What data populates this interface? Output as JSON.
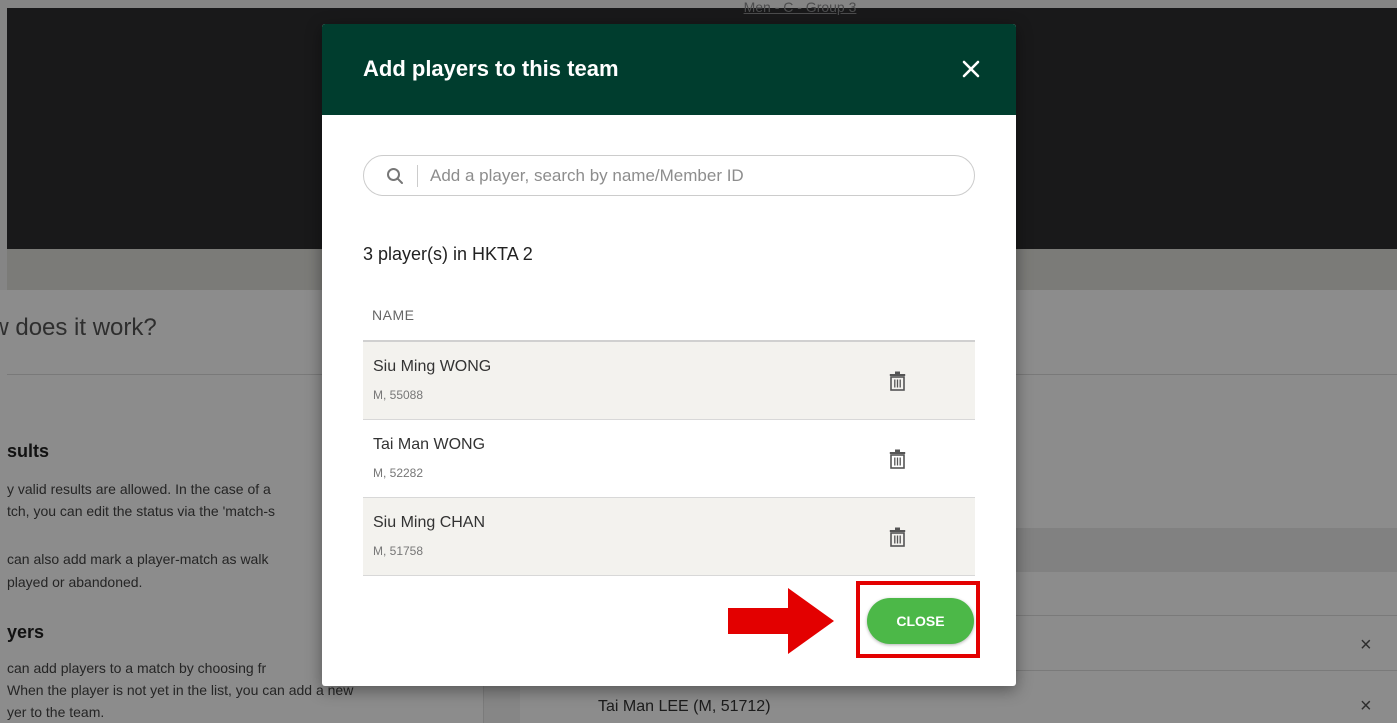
{
  "background": {
    "header_subtitle": "Men - C - Group 3",
    "section_title": "ow does it work?",
    "results": {
      "heading": "sults",
      "lines": [
        "y valid results are allowed. In the case of a",
        "tch, you can edit the status via the 'match-s",
        "",
        "can also add mark a player-match as walk",
        "played or abandoned."
      ]
    },
    "players": {
      "heading": "yers",
      "lines": [
        "can add players to a match by choosing fr",
        "When the player is not yet in the list, you can add a new",
        "yer to the team."
      ]
    },
    "right_row_text": "Tai Man LEE (M, 51712)",
    "remove_glyph": "×"
  },
  "modal": {
    "title": "Add players to this team",
    "search": {
      "placeholder": "Add a player, search by name/Member ID"
    },
    "count_text": "3 player(s) in HKTA 2",
    "column_header": "NAME",
    "players": [
      {
        "name": "Siu Ming WONG",
        "meta": "M, 55088"
      },
      {
        "name": "Tai Man WONG",
        "meta": "M, 52282"
      },
      {
        "name": "Siu Ming CHAN",
        "meta": "M, 51758"
      }
    ],
    "close_label": "CLOSE"
  },
  "colors": {
    "modal_header": "#003d2e",
    "close_button": "#4cb848",
    "annotation": "#e30000"
  }
}
